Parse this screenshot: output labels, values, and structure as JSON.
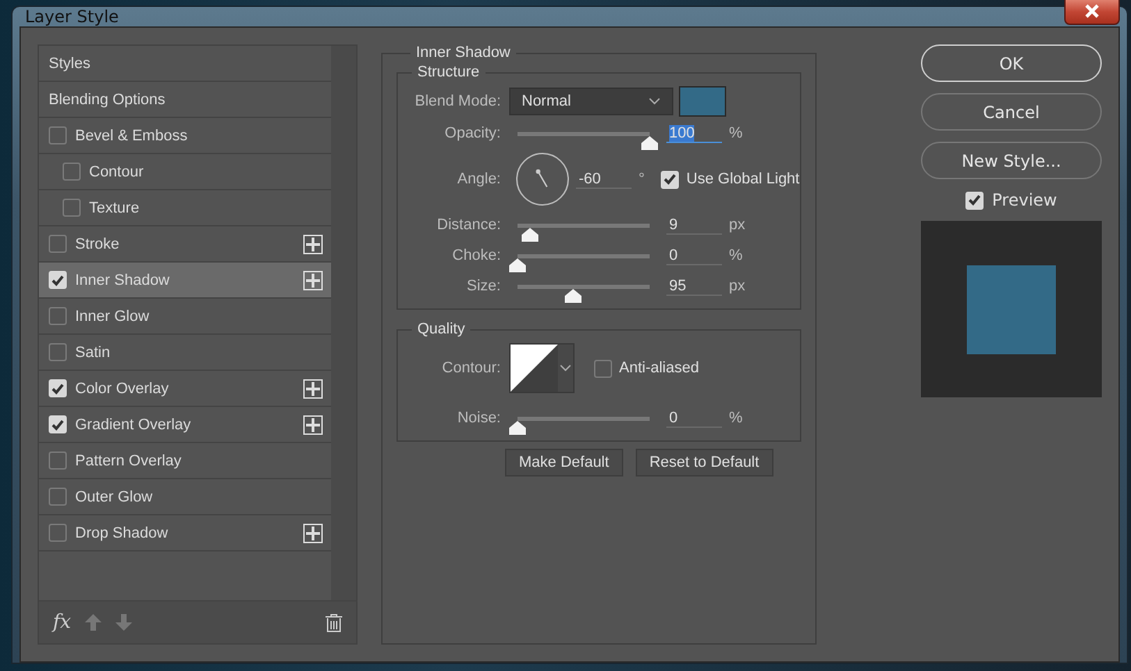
{
  "window": {
    "title": "Layer Style"
  },
  "sidebar": {
    "items": [
      {
        "label": "Styles",
        "kind": "header",
        "selected": false
      },
      {
        "label": "Blending Options",
        "kind": "header",
        "selected": false
      },
      {
        "label": "Bevel & Emboss",
        "kind": "effect",
        "checked": false,
        "selected": false,
        "addable": false,
        "children": [
          {
            "label": "Contour",
            "kind": "effect",
            "checked": false,
            "selected": false,
            "addable": false
          },
          {
            "label": "Texture",
            "kind": "effect",
            "checked": false,
            "selected": false,
            "addable": false
          }
        ]
      },
      {
        "label": "Stroke",
        "kind": "effect",
        "checked": false,
        "selected": false,
        "addable": true
      },
      {
        "label": "Inner Shadow",
        "kind": "effect",
        "checked": true,
        "selected": true,
        "addable": true
      },
      {
        "label": "Inner Glow",
        "kind": "effect",
        "checked": false,
        "selected": false,
        "addable": false
      },
      {
        "label": "Satin",
        "kind": "effect",
        "checked": false,
        "selected": false,
        "addable": false
      },
      {
        "label": "Color Overlay",
        "kind": "effect",
        "checked": true,
        "selected": false,
        "addable": true
      },
      {
        "label": "Gradient Overlay",
        "kind": "effect",
        "checked": true,
        "selected": false,
        "addable": true
      },
      {
        "label": "Pattern Overlay",
        "kind": "effect",
        "checked": false,
        "selected": false,
        "addable": false
      },
      {
        "label": "Outer Glow",
        "kind": "effect",
        "checked": false,
        "selected": false,
        "addable": false
      },
      {
        "label": "Drop Shadow",
        "kind": "effect",
        "checked": false,
        "selected": false,
        "addable": true
      }
    ],
    "footer": {
      "fx_label": "fx"
    }
  },
  "panel": {
    "title": "Inner Shadow",
    "structure": {
      "title": "Structure",
      "blend_mode": {
        "label": "Blend Mode:",
        "value": "Normal",
        "color": "#336a87"
      },
      "opacity": {
        "label": "Opacity:",
        "level": 1.0,
        "value": "100",
        "unit": "%",
        "text_selected": true
      },
      "angle": {
        "label": "Angle:",
        "value": "-60",
        "unit": "°"
      },
      "use_global_light": {
        "label": "Use Global Light",
        "checked": true
      },
      "sliders": [
        {
          "label": "Distance:",
          "level": 0.09,
          "value": "9",
          "unit": "px"
        },
        {
          "label": "Choke:",
          "level": 0.0,
          "value": "0",
          "unit": "%"
        },
        {
          "label": "Size:",
          "level": 0.42,
          "value": "95",
          "unit": "px"
        }
      ]
    },
    "quality": {
      "title": "Quality",
      "contour": {
        "label": "Contour:"
      },
      "anti_aliased": {
        "label": "Anti-aliased",
        "checked": false
      },
      "noise": {
        "label": "Noise:",
        "level": 0.0,
        "value": "0",
        "unit": "%"
      }
    },
    "buttons": [
      "Make Default",
      "Reset to Default"
    ]
  },
  "actions": [
    {
      "label": "OK",
      "default": true
    },
    {
      "label": "Cancel",
      "default": false
    },
    {
      "label": "New Style...",
      "default": false
    }
  ],
  "preview": {
    "label": "Preview",
    "checked": true,
    "color": "#336a87"
  }
}
